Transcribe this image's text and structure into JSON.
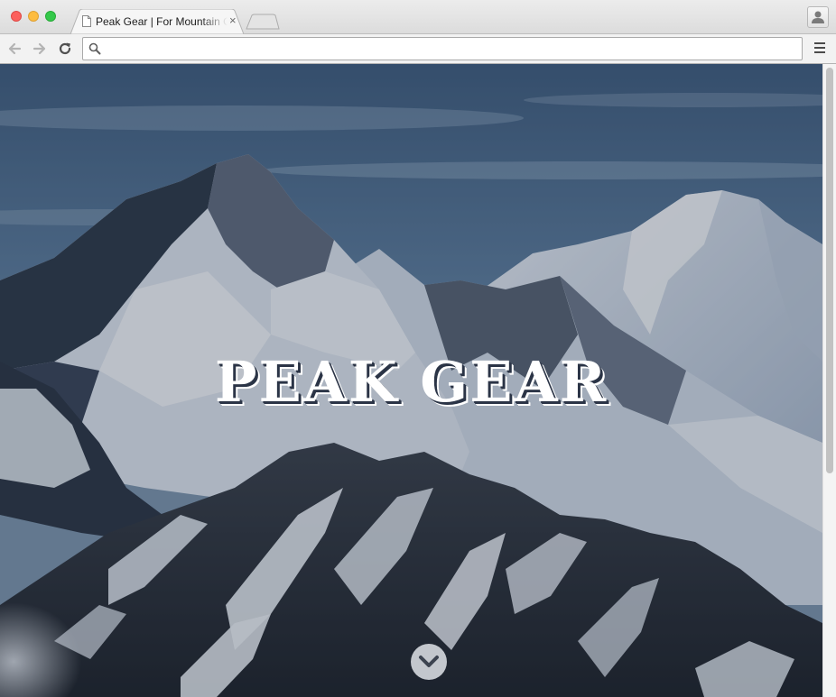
{
  "browser": {
    "tab": {
      "title": "Peak Gear | For Mountain Climbers",
      "close_glyph": "×"
    },
    "address_bar": {
      "value": "",
      "placeholder": ""
    },
    "icons": [
      "close-window-icon",
      "minimize-window-icon",
      "zoom-window-icon",
      "document-icon",
      "close-tab-icon",
      "new-tab-icon",
      "profile-icon",
      "back-arrow-icon",
      "forward-arrow-icon",
      "reload-icon",
      "search-icon",
      "menu-icon"
    ]
  },
  "page": {
    "hero": {
      "title": "PEAK GEAR",
      "scroll_icon": "chevron-down-icon"
    }
  },
  "colors": {
    "title_text": "#ffffff",
    "title_shadow": "#2b3446",
    "sky": "#4d6a8a",
    "overlay": "#1e2a3f"
  }
}
